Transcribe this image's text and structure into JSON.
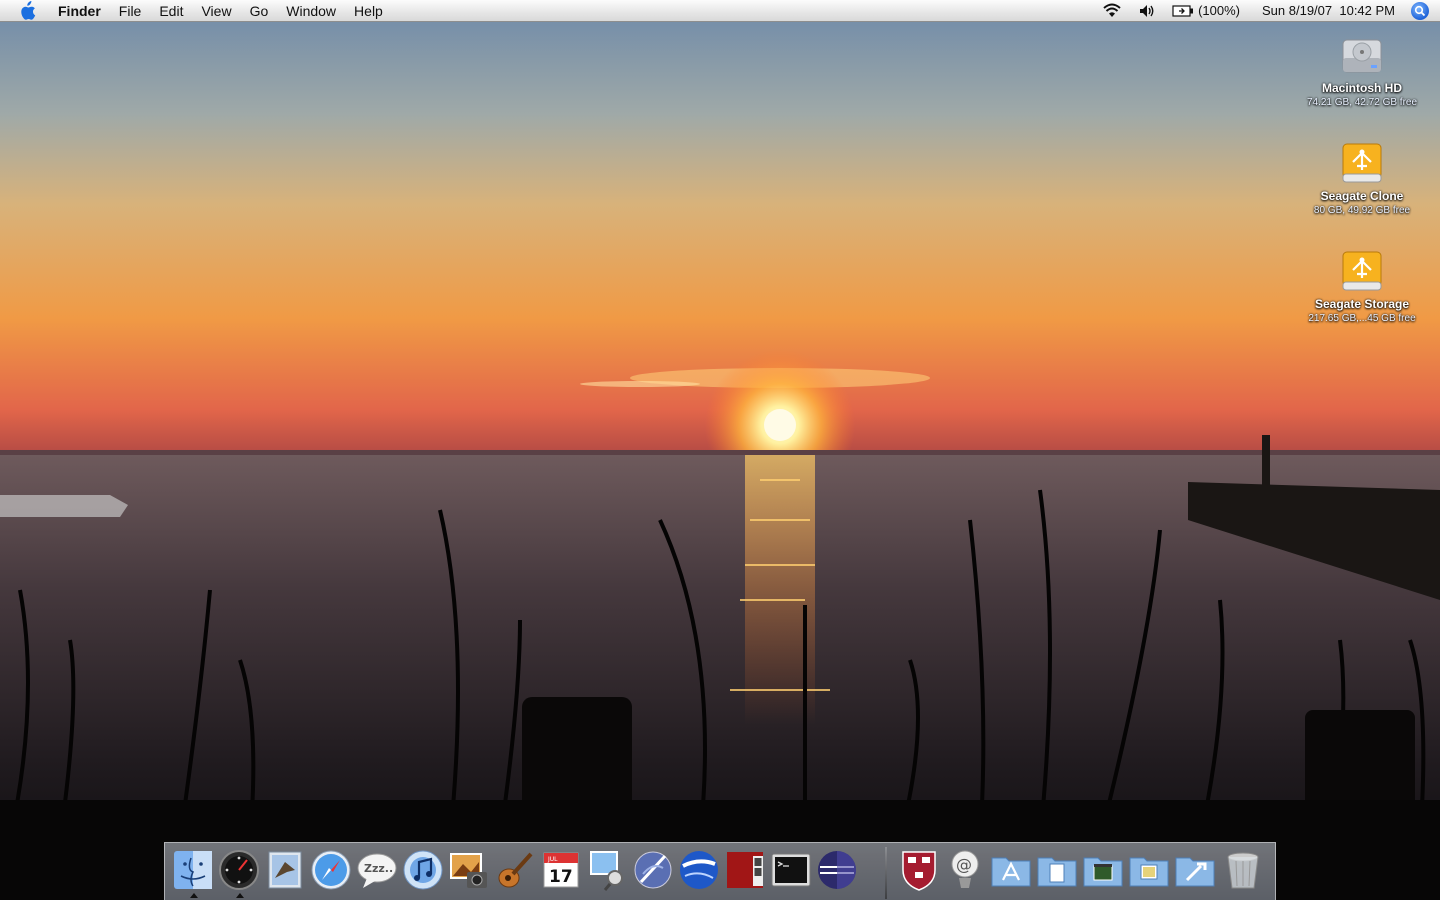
{
  "menubar": {
    "app_name": "Finder",
    "menus": [
      "File",
      "Edit",
      "View",
      "Go",
      "Window",
      "Help"
    ],
    "battery": "(100%)",
    "datetime": "Sun 8/19/07  10:42 PM",
    "icons": [
      "apple-icon",
      "wifi-icon",
      "volume-icon",
      "battery-icon",
      "spotlight-icon"
    ]
  },
  "desktop": {
    "drives": [
      {
        "name": "Macintosh HD",
        "info": "74.21 GB, 42.72 GB free",
        "icon": "hard-drive-icon"
      },
      {
        "name": "Seagate Clone",
        "info": "80 GB, 49.92 GB free",
        "icon": "firewire-drive-icon"
      },
      {
        "name": "Seagate Storage",
        "info": "217.65 GB,...45 GB free",
        "icon": "firewire-drive-icon"
      }
    ]
  },
  "dock": {
    "apps": [
      "finder-icon",
      "dashboard-icon",
      "mail-icon",
      "safari-icon",
      "ichat-icon",
      "itunes-icon",
      "iphoto-icon",
      "garageband-icon",
      "ical-icon",
      "preview-icon",
      "iweb-icon",
      "google-earth-icon",
      "photo-booth-icon",
      "terminal-icon",
      "eclipse-icon"
    ],
    "stacks": [
      "university-shield-icon",
      "mail-server-icon",
      "applications-folder-icon",
      "documents-folder-icon",
      "movies-folder-icon",
      "pictures-folder-icon",
      "utilities-folder-icon",
      "trash-icon"
    ],
    "calendar_month": "JUL",
    "calendar_day": "17",
    "colors": {
      "accent": "#1f63d8",
      "sun": "#fff6b0"
    }
  }
}
